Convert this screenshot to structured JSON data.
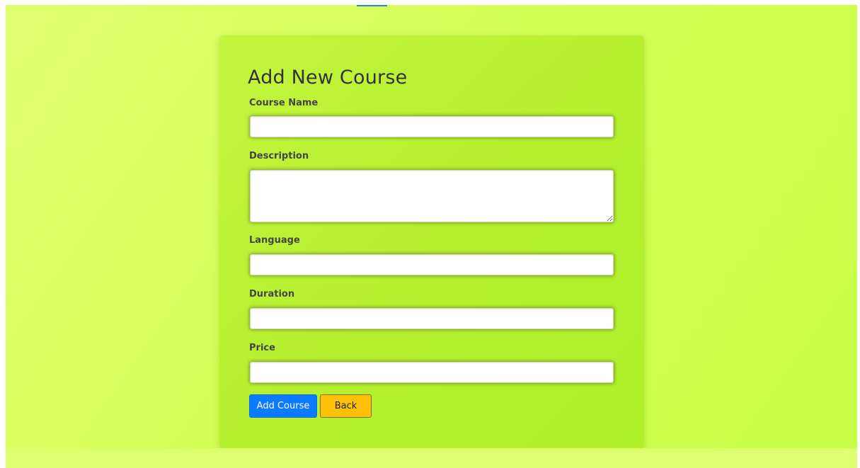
{
  "form": {
    "title": "Add New Course",
    "fields": {
      "course_name": {
        "label": "Course Name",
        "value": "",
        "placeholder": ""
      },
      "description": {
        "label": "Description",
        "value": "",
        "placeholder": ""
      },
      "language": {
        "label": "Language",
        "value": "",
        "placeholder": ""
      },
      "duration": {
        "label": "Duration",
        "value": "",
        "placeholder": ""
      },
      "price": {
        "label": "Price",
        "value": "",
        "placeholder": ""
      }
    },
    "buttons": {
      "add_course": "Add Course",
      "back": "Back"
    }
  },
  "colors": {
    "page_background": "#d4ff55",
    "card_background": "#b5f02f",
    "primary_button": "#0a7bff",
    "warning_button": "#ffc107",
    "top_accent": "#2f86d6"
  }
}
